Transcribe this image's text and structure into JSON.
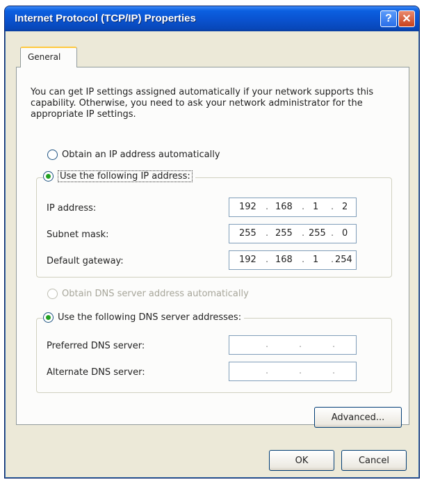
{
  "window": {
    "title": "Internet Protocol (TCP/IP) Properties"
  },
  "titlebar": {
    "help_glyph": "?",
    "close_glyph": "✕"
  },
  "tabs": [
    {
      "label": "General"
    }
  ],
  "intro_text": "You can get IP settings assigned automatically if your network supports this capability. Otherwise, you need to ask your network administrator for the appropriate IP settings.",
  "ip": {
    "auto_option": "Obtain an IP address automatically",
    "manual_option": "Use the following IP address:",
    "selected": "manual",
    "fields": [
      {
        "label": "IP address:",
        "octets": [
          "192",
          "168",
          "1",
          "2"
        ]
      },
      {
        "label": "Subnet mask:",
        "octets": [
          "255",
          "255",
          "255",
          "0"
        ]
      },
      {
        "label": "Default gateway:",
        "octets": [
          "192",
          "168",
          "1",
          "254"
        ]
      }
    ]
  },
  "dns": {
    "auto_option": "Obtain DNS server address automatically",
    "auto_disabled": true,
    "manual_option": "Use the following DNS server addresses:",
    "selected": "manual",
    "fields": [
      {
        "label": "Preferred DNS server:",
        "octets": [
          "",
          "",
          "",
          ""
        ]
      },
      {
        "label": "Alternate DNS server:",
        "octets": [
          "",
          "",
          "",
          ""
        ]
      }
    ]
  },
  "buttons": {
    "advanced": "Advanced...",
    "ok": "OK",
    "cancel": "Cancel"
  },
  "colors": {
    "titlebar": "#0a52cf",
    "dialog_bg": "#ece9d8",
    "radio_selected": "#21a121",
    "tab_highlight": "#ffc83c"
  }
}
